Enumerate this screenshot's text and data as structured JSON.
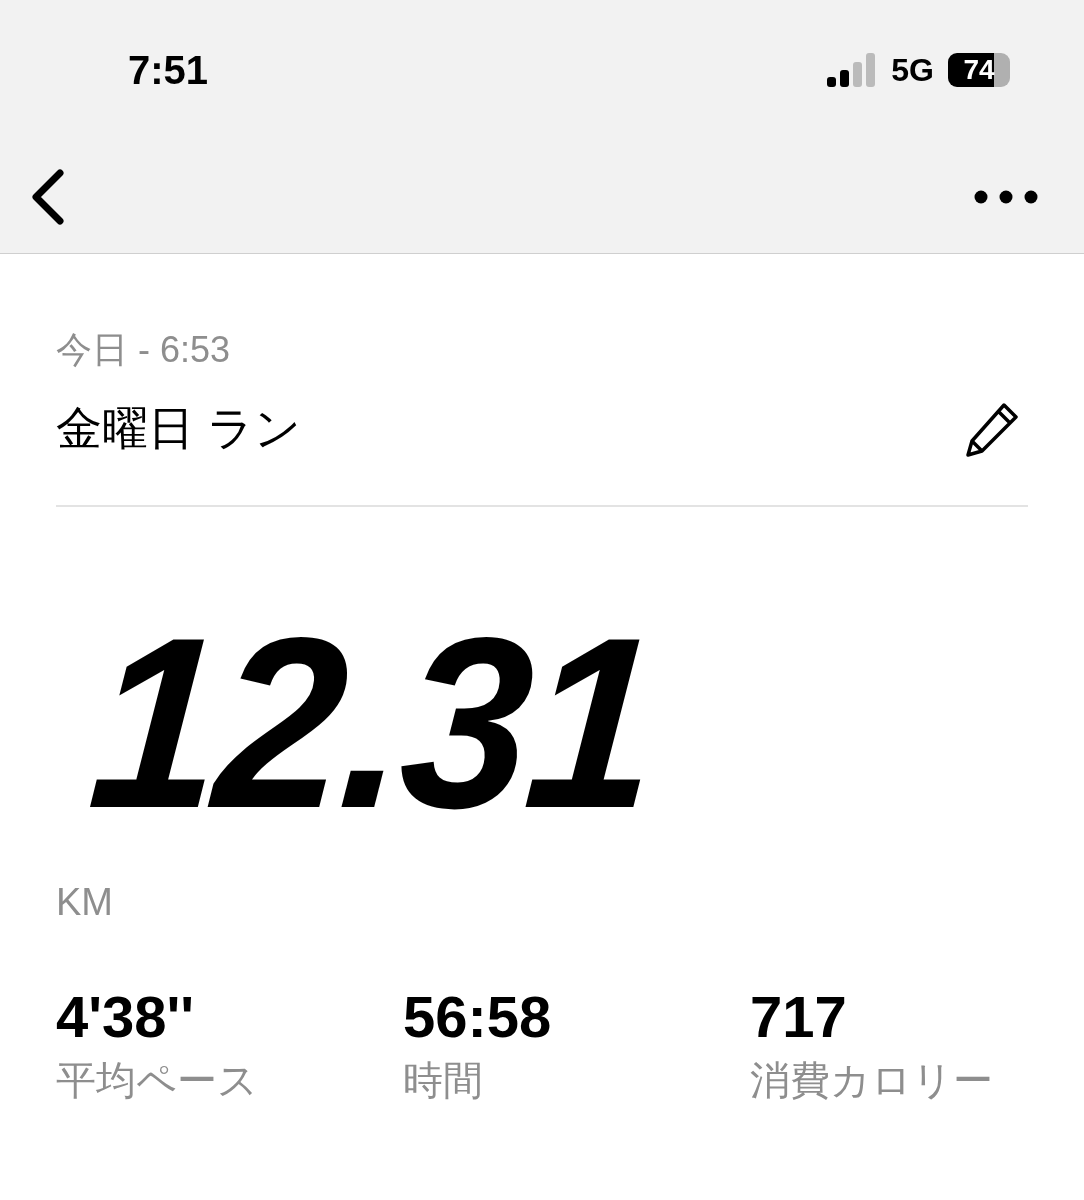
{
  "status_bar": {
    "time": "7:51",
    "network": "5G",
    "battery": "74"
  },
  "header": {
    "subtitle": "今日 - 6:53",
    "title": "金曜日 ラン"
  },
  "distance": {
    "value": "12.31",
    "unit": "KM"
  },
  "stats": [
    {
      "value": "4'38''",
      "label": "平均ペース"
    },
    {
      "value": "56:58",
      "label": "時間"
    },
    {
      "value": "717",
      "label": "消費カロリー"
    }
  ]
}
